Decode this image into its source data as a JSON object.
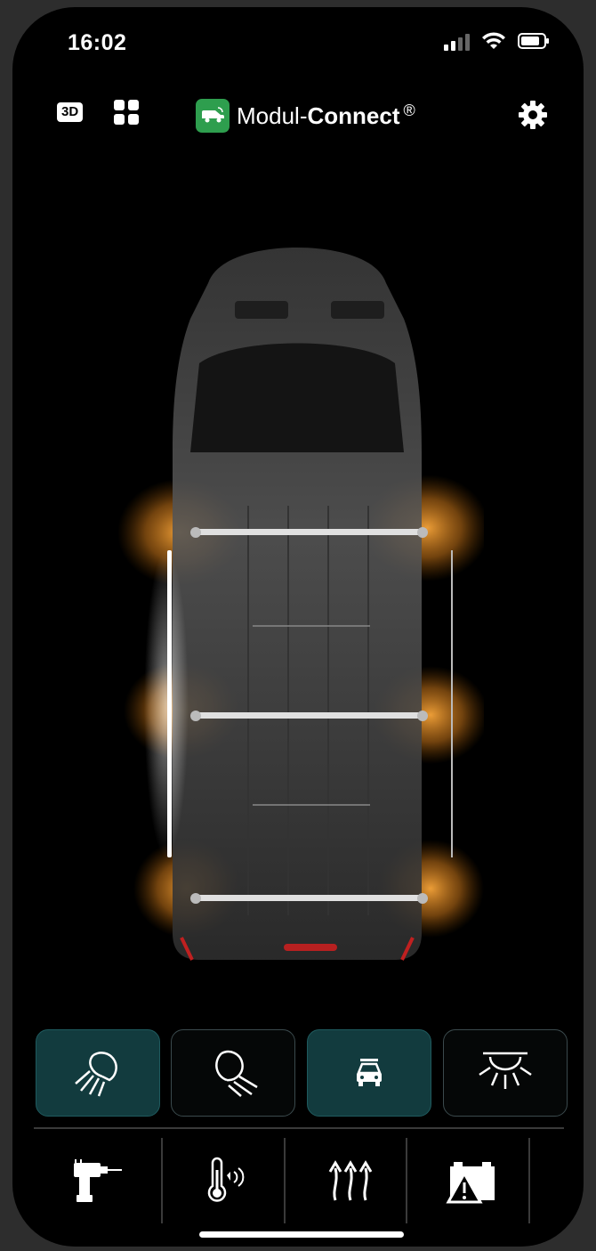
{
  "status_bar": {
    "time": "16:02",
    "icons": [
      "cellular-signal-icon",
      "wifi-icon",
      "battery-icon"
    ]
  },
  "header": {
    "badge_3d": "3D",
    "brand_name_regular": "Modul-",
    "brand_name_bold": "Connect",
    "brand_registered": "®",
    "icons": [
      "grid-icon",
      "van-logo-icon",
      "gear-icon"
    ]
  },
  "vehicle": {
    "view": "top-down van with roof rack",
    "roof_bars": 3,
    "light_colors": {
      "amber": "#f7a53a",
      "white": "#ffffff"
    }
  },
  "modes": [
    {
      "name": "work-light-mode",
      "icon": "headlight-icon",
      "active": true
    },
    {
      "name": "low-beam-mode",
      "icon": "headlight-dim-icon",
      "active": false
    },
    {
      "name": "vehicle-lights-mode",
      "icon": "car-roof-rack-icon",
      "active": true
    },
    {
      "name": "ceiling-light-mode",
      "icon": "ceiling-lamp-icon",
      "active": false
    }
  ],
  "tools": [
    {
      "name": "drill-tool",
      "icon": "drill-icon"
    },
    {
      "name": "temperature-tool",
      "icon": "thermometer-icon"
    },
    {
      "name": "ventilation-tool",
      "icon": "airflow-arrows-icon"
    },
    {
      "name": "battery-warning-tool",
      "icon": "battery-warning-icon"
    }
  ],
  "colors": {
    "accent_active": "#123b3e",
    "background": "#000000",
    "brand_green": "#2e9e4e"
  }
}
